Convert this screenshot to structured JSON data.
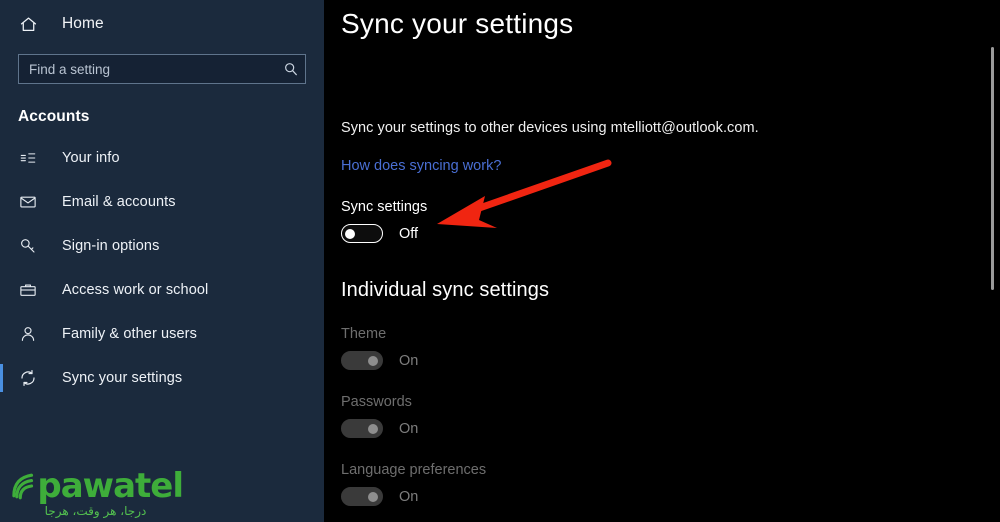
{
  "sidebar": {
    "home": {
      "label": "Home",
      "icon": "home-icon"
    },
    "search": {
      "placeholder": "Find a setting",
      "value": "",
      "icon": "search-icon"
    },
    "category_title": "Accounts",
    "items": [
      {
        "label": "Your info",
        "icon": "contact-card-icon",
        "selected": false
      },
      {
        "label": "Email & accounts",
        "icon": "envelope-icon",
        "selected": false
      },
      {
        "label": "Sign-in options",
        "icon": "key-icon",
        "selected": false
      },
      {
        "label": "Access work or school",
        "icon": "briefcase-icon",
        "selected": false
      },
      {
        "label": "Family & other users",
        "icon": "person-icon",
        "selected": false
      },
      {
        "label": "Sync your settings",
        "icon": "sync-arrows-icon",
        "selected": true
      }
    ],
    "watermark": {
      "brand": "pawatel",
      "tagline": "درجا، هر وقت، هرجا"
    }
  },
  "main": {
    "title": "Sync your settings",
    "description": "Sync your settings to other devices using mtelliott@outlook.com.",
    "link": "How does syncing work?",
    "sync_settings": {
      "label": "Sync settings",
      "state": "Off",
      "enabled": true
    },
    "group_heading": "Individual sync settings",
    "individual": [
      {
        "label": "Theme",
        "state": "On",
        "disabled": true
      },
      {
        "label": "Passwords",
        "state": "On",
        "disabled": true
      },
      {
        "label": "Language preferences",
        "state": "On",
        "disabled": true
      }
    ]
  },
  "annotation": {
    "type": "arrow",
    "color": "#f02511",
    "points_to": "sync-settings-toggle"
  },
  "colors": {
    "sidebar_bg": "#1b2a3d",
    "content_bg": "#000000",
    "accent": "#4a90e2",
    "link": "#4a6fd4",
    "annotation_red": "#f02511",
    "watermark_green": "#3ead3a"
  }
}
